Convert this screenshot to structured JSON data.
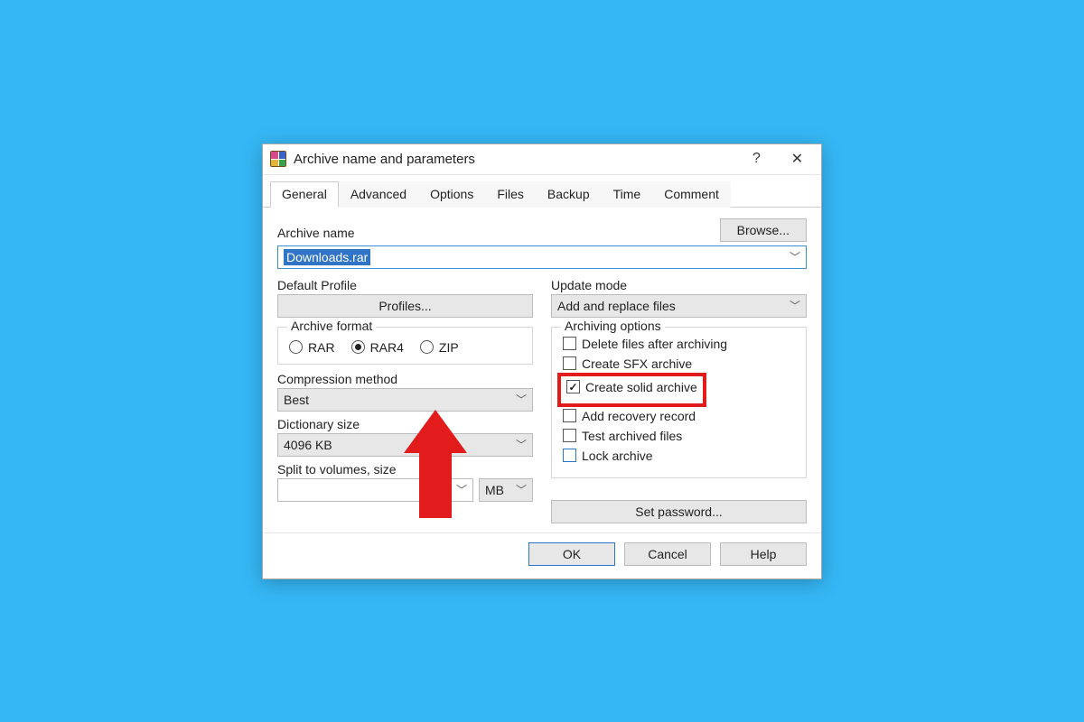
{
  "title": "Archive name and parameters",
  "tabs": [
    "General",
    "Advanced",
    "Options",
    "Files",
    "Backup",
    "Time",
    "Comment"
  ],
  "active_tab": 0,
  "archive_name_label": "Archive name",
  "archive_name_value": "Downloads.rar",
  "browse_label": "Browse...",
  "default_profile_label": "Default Profile",
  "profiles_btn": "Profiles...",
  "update_mode_label": "Update mode",
  "update_mode_value": "Add and replace files",
  "archive_format_label": "Archive format",
  "formats": [
    {
      "label": "RAR",
      "checked": false
    },
    {
      "label": "RAR4",
      "checked": true
    },
    {
      "label": "ZIP",
      "checked": false
    }
  ],
  "compression_label": "Compression method",
  "compression_value": "Best",
  "dictionary_label": "Dictionary size",
  "dictionary_value": "4096 KB",
  "split_label": "Split to volumes, size",
  "split_value": "",
  "split_unit": "MB",
  "archiving_options_label": "Archiving options",
  "options": [
    {
      "label": "Delete files after archiving",
      "checked": false,
      "blue": false
    },
    {
      "label": "Create SFX archive",
      "checked": false,
      "blue": false
    },
    {
      "label": "Create solid archive",
      "checked": true,
      "blue": false,
      "highlight": true
    },
    {
      "label": "Add recovery record",
      "checked": false,
      "blue": false
    },
    {
      "label": "Test archived files",
      "checked": false,
      "blue": false
    },
    {
      "label": "Lock archive",
      "checked": false,
      "blue": true
    }
  ],
  "set_password_label": "Set password...",
  "buttons": {
    "ok": "OK",
    "cancel": "Cancel",
    "help": "Help"
  }
}
